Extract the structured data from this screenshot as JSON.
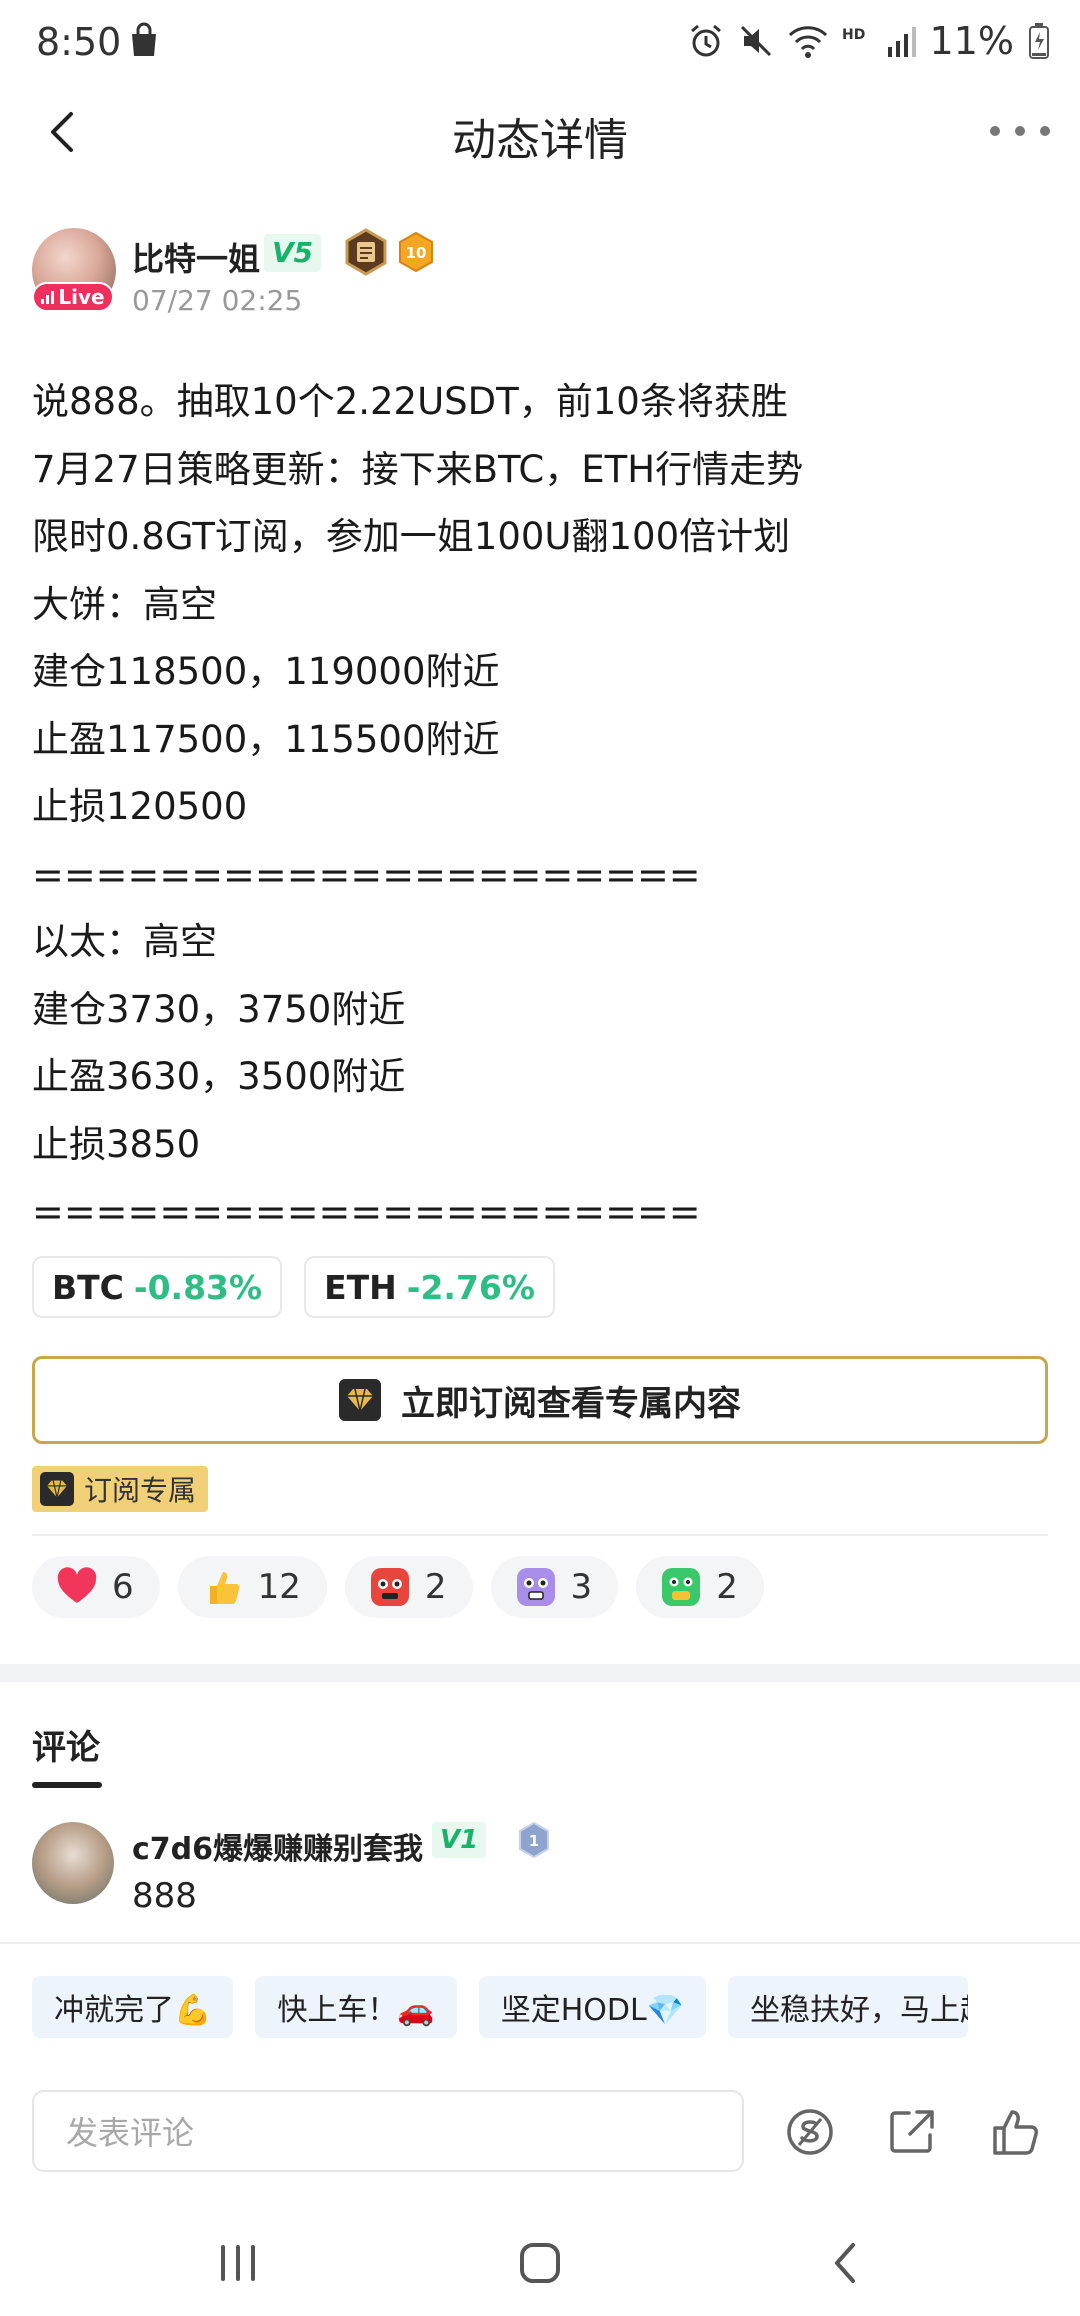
{
  "status_bar": {
    "time": "8:50",
    "battery": "11%",
    "icons": [
      "shopping-bag-icon",
      "alarm-icon",
      "mute-icon",
      "wifi-icon",
      "hd-icon",
      "signal-icon",
      "battery-icon"
    ]
  },
  "header": {
    "title": "动态详情",
    "back_icon": "chevron-left-icon",
    "more_icon": "more-dots-icon"
  },
  "author": {
    "name": "比特一姐",
    "vip": "V5",
    "live": "Live",
    "medal_level": "10",
    "time": "07/27 02:25"
  },
  "post": {
    "lines": [
      "说888。抽取10个2.22USDT，前10条将获胜",
      "7月27日策略更新：接下来BTC，ETH行情走势",
      "限时0.8GT订阅，参加一姐100U翻100倍计划",
      "大饼：高空",
      "建仓118500，119000附近",
      "止盈117500，115500附近",
      "止损120500",
      "=====================",
      "以太：高空",
      "建仓3730，3750附近",
      "止盈3630，3500附近",
      "止损3850",
      "====================="
    ]
  },
  "tickers": [
    {
      "symbol": "BTC",
      "change": "-0.83%"
    },
    {
      "symbol": "ETH",
      "change": "-2.76%"
    }
  ],
  "subscribe": {
    "button": "立即订阅查看专属内容",
    "tag": "订阅专属"
  },
  "reactions": [
    {
      "icon": "heart-icon",
      "count": "6"
    },
    {
      "icon": "thumbs-up-emoji-icon",
      "count": "12"
    },
    {
      "icon": "angry-face-icon",
      "count": "2"
    },
    {
      "icon": "shocked-face-icon",
      "count": "3"
    },
    {
      "icon": "sick-face-icon",
      "count": "2"
    }
  ],
  "comments": {
    "title": "评论",
    "items": [
      {
        "name": "c7d6爆爆赚赚别套我",
        "vip": "V1",
        "medal": "1",
        "text": "888"
      }
    ]
  },
  "quick_replies": [
    "冲就完了💪",
    "快上车！🚗",
    "坚定HODL💎",
    "坐稳扶好，马上起飞"
  ],
  "comment_bar": {
    "placeholder": "发表评论",
    "icons": [
      "tip-coin-icon",
      "share-icon",
      "like-icon"
    ]
  },
  "system_nav": [
    "recent-apps-icon",
    "home-icon",
    "back-icon"
  ],
  "colors": {
    "accent_green": "#2ebd85",
    "vip_green": "#18b36b",
    "gold": "#c9a64a",
    "live_red": "#f0305c"
  }
}
